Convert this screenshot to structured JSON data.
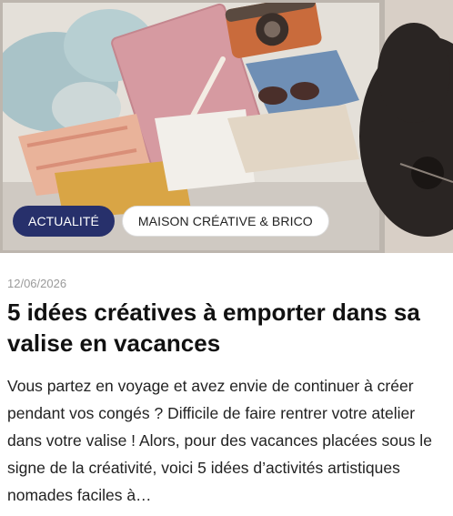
{
  "article": {
    "tags": {
      "primary": "ACTUALITÉ",
      "secondary": "MAISON CRÉATIVE & BRICO"
    },
    "date": "12/06/2026",
    "title": "5 idées créatives à emporter dans sa valise en vacances",
    "excerpt": "Vous partez en voyage et avez envie de continuer à créer pendant vos congés ? Difficile de faire rentrer votre atelier dans votre valise ! Alors, pour des vacances placées sous le signe de la créativité, voici 5 idées d’activités artistiques nomades faciles à…"
  },
  "colors": {
    "accent": "#27306b",
    "text": "#111111",
    "muted": "#9a9a9a"
  }
}
